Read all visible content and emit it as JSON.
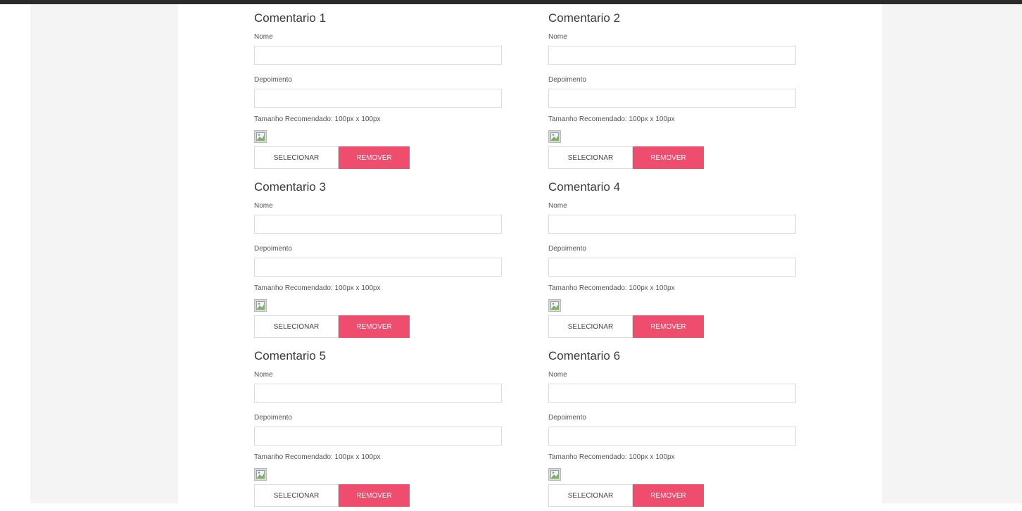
{
  "labels": {
    "nome": "Nome",
    "depoimento": "Depoimento",
    "size_note": "Tamanho Recomendado: 100px x 100px",
    "select_button": "SELECIONAR",
    "remove_button": "REMOVER"
  },
  "comments": [
    {
      "title": "Comentario 1",
      "nome_value": "",
      "depoimento_value": ""
    },
    {
      "title": "Comentario 2",
      "nome_value": "",
      "depoimento_value": ""
    },
    {
      "title": "Comentario 3",
      "nome_value": "",
      "depoimento_value": ""
    },
    {
      "title": "Comentario 4",
      "nome_value": "",
      "depoimento_value": ""
    },
    {
      "title": "Comentario 5",
      "nome_value": "",
      "depoimento_value": ""
    },
    {
      "title": "Comentario 6",
      "nome_value": "",
      "depoimento_value": ""
    }
  ],
  "icons": {
    "thumbnail": "broken-image-icon"
  },
  "colors": {
    "remove_button": "#ef4d6e",
    "top_bar": "#2b2b2b",
    "page_background": "#f4f4f4"
  }
}
